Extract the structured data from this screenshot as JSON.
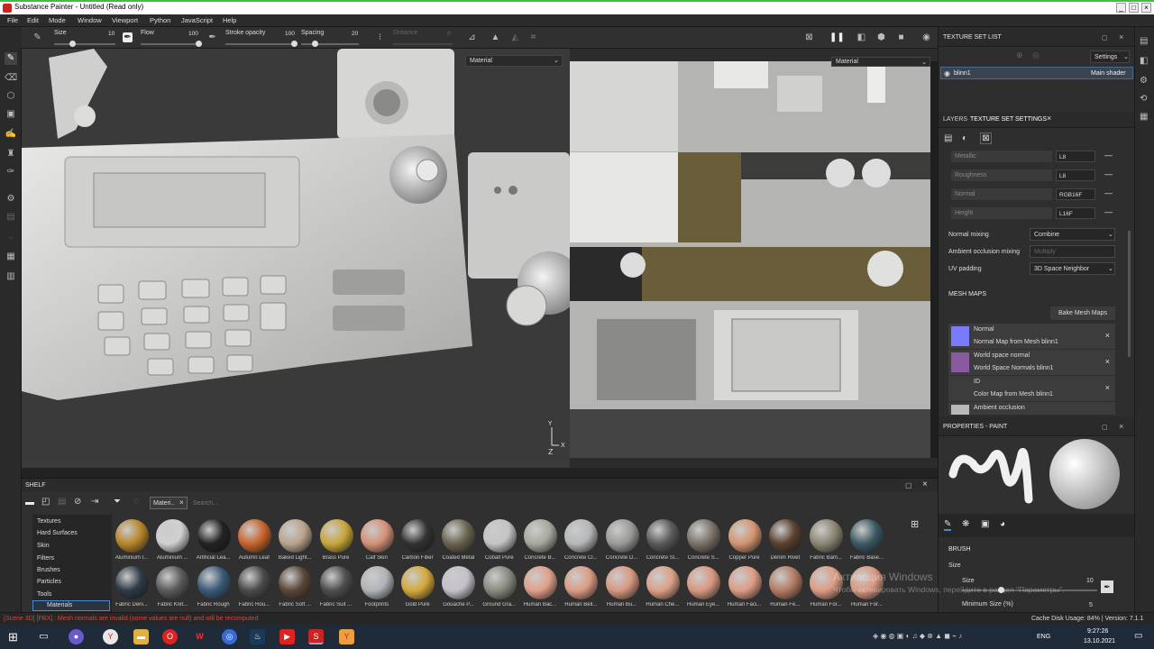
{
  "window": {
    "title": "Substance Painter - Untitled (Read only)"
  },
  "menu": [
    "File",
    "Edit",
    "Mode",
    "Window",
    "Viewport",
    "Python",
    "JavaScript",
    "Help"
  ],
  "tool_params": {
    "size": {
      "label": "Size",
      "value": "10"
    },
    "flow": {
      "label": "Flow",
      "value": "100"
    },
    "stroke_opacity": {
      "label": "Stroke opacity",
      "value": "100"
    },
    "spacing": {
      "label": "Spacing",
      "value": "20"
    },
    "distance": {
      "label": "Distance",
      "value": "0"
    }
  },
  "viewport3d": {
    "mode": "Material"
  },
  "viewport2d": {
    "mode": "Material"
  },
  "shelf": {
    "title": "SHELF",
    "filter_tag": "Materi..",
    "search_placeholder": "Search...",
    "categories": [
      "Textures",
      "Hard Surfaces",
      "Skin",
      "Filters",
      "Brushes",
      "Particles",
      "Tools",
      "Materials"
    ],
    "selected_category": "Materials",
    "row1": [
      {
        "name": "Aluminium I...",
        "color": "#b8862a"
      },
      {
        "name": "Aluminium ...",
        "color": "#d0d0d0"
      },
      {
        "name": "Artificial Lea...",
        "color": "#222222"
      },
      {
        "name": "Autumn Leaf",
        "color": "#c8642c"
      },
      {
        "name": "Baked Light...",
        "color": "#b9a48c"
      },
      {
        "name": "Brass Pure",
        "color": "#c8a63a"
      },
      {
        "name": "Calf Skin",
        "color": "#d49078"
      },
      {
        "name": "Carbon Fiber",
        "color": "#333333"
      },
      {
        "name": "Coated Metal",
        "color": "#6a6450"
      },
      {
        "name": "Cobalt Pure",
        "color": "#c4c4c4"
      },
      {
        "name": "Concrete B...",
        "color": "#a8a8a0"
      },
      {
        "name": "Concrete Cl...",
        "color": "#b4b8b8"
      },
      {
        "name": "Concrete D...",
        "color": "#9a9a98"
      },
      {
        "name": "Concrete Sl...",
        "color": "#5a5a5a"
      },
      {
        "name": "Concrete S...",
        "color": "#7a7266"
      },
      {
        "name": "Copper Pure",
        "color": "#d49470"
      },
      {
        "name": "Denim Rivet",
        "color": "#5a4030"
      },
      {
        "name": "Fabric Bam...",
        "color": "#8a8672"
      },
      {
        "name": "Fabric Base...",
        "color": "#3c5a64"
      }
    ],
    "row2": [
      {
        "name": "Fabric Deni...",
        "color": "#2e3a46"
      },
      {
        "name": "Fabric Knit...",
        "color": "#5a5a5a"
      },
      {
        "name": "Fabric Rough",
        "color": "#3a5a78"
      },
      {
        "name": "Fabric Rou...",
        "color": "#4a4a4a"
      },
      {
        "name": "Fabric Soft ...",
        "color": "#5a4638"
      },
      {
        "name": "Fabric Suit ...",
        "color": "#4e4e4e"
      },
      {
        "name": "Footprints",
        "color": "#b0b4b8"
      },
      {
        "name": "Gold Pure",
        "color": "#d4a83a"
      },
      {
        "name": "Gouache P...",
        "color": "#c4c0c8"
      },
      {
        "name": "Ground Gra...",
        "color": "#8a8a80"
      },
      {
        "name": "Human Bac...",
        "color": "#e0a088"
      },
      {
        "name": "Human Bell...",
        "color": "#dc9c84"
      },
      {
        "name": "Human Bu...",
        "color": "#d89880"
      },
      {
        "name": "Human Che...",
        "color": "#dca088"
      },
      {
        "name": "Human Eye...",
        "color": "#d89880"
      },
      {
        "name": "Human Faci...",
        "color": "#dc9c84"
      },
      {
        "name": "Human Fe...",
        "color": "#b47c64"
      },
      {
        "name": "Human For...",
        "color": "#dc9c84"
      },
      {
        "name": "Human For...",
        "color": "#d89880"
      }
    ]
  },
  "texture_set_list": {
    "title": "TEXTURE SET LIST",
    "settings": "Settings",
    "item_name": "blinn1",
    "item_shader": "Main shader"
  },
  "tabs": {
    "layers": "LAYERS",
    "tss": "TEXTURE SET SETTINGS"
  },
  "channels": [
    {
      "name": "Metallic",
      "format": "L8"
    },
    {
      "name": "Roughness",
      "format": "L8"
    },
    {
      "name": "Normal",
      "format": "RGB16F"
    },
    {
      "name": "Height",
      "format": "L16F"
    }
  ],
  "settings": {
    "normal_mixing": {
      "label": "Normal mixing",
      "value": "Combine"
    },
    "ao_mixing": {
      "label": "Ambient occlusion mixing",
      "value": "Multiply"
    },
    "uv_padding": {
      "label": "UV padding",
      "value": "3D Space Neighbor"
    }
  },
  "mesh_maps": {
    "title": "MESH MAPS",
    "bake_button": "Bake Mesh Maps",
    "items": [
      {
        "name": "Normal",
        "source": "Normal Map from Mesh blinn1",
        "color": "#7a7aff"
      },
      {
        "name": "World space normal",
        "source": "World Space Normals blinn1",
        "color": "#8a5aa0"
      },
      {
        "name": "ID",
        "source": "Color Map from Mesh blinn1",
        "color": "#3c3c3c"
      },
      {
        "name": "Ambient occlusion",
        "source": "",
        "color": "#b8b8b8"
      }
    ]
  },
  "properties": {
    "title": "PROPERTIES - PAINT",
    "brush_section": "BRUSH",
    "size_label": "Size",
    "size_sub_label": "Size",
    "size_value": "10",
    "min_size_label": "Minimum Size (%)",
    "min_size_value": "5"
  },
  "status": {
    "error": "[Scene 3D] [FBX] : Mesh normals are invalid (some values are null) and will be recomputed",
    "cache": "Cache Disk Usage:  84% | Version: 7.1.1"
  },
  "watermark": {
    "line1": "Активация Windows",
    "line2": "Чтобы активировать Windows, перейдите в раздел \"Параметры\"."
  },
  "taskbar": {
    "lang": "ENG",
    "time": "9:27:26",
    "date": "13.10.2021"
  }
}
